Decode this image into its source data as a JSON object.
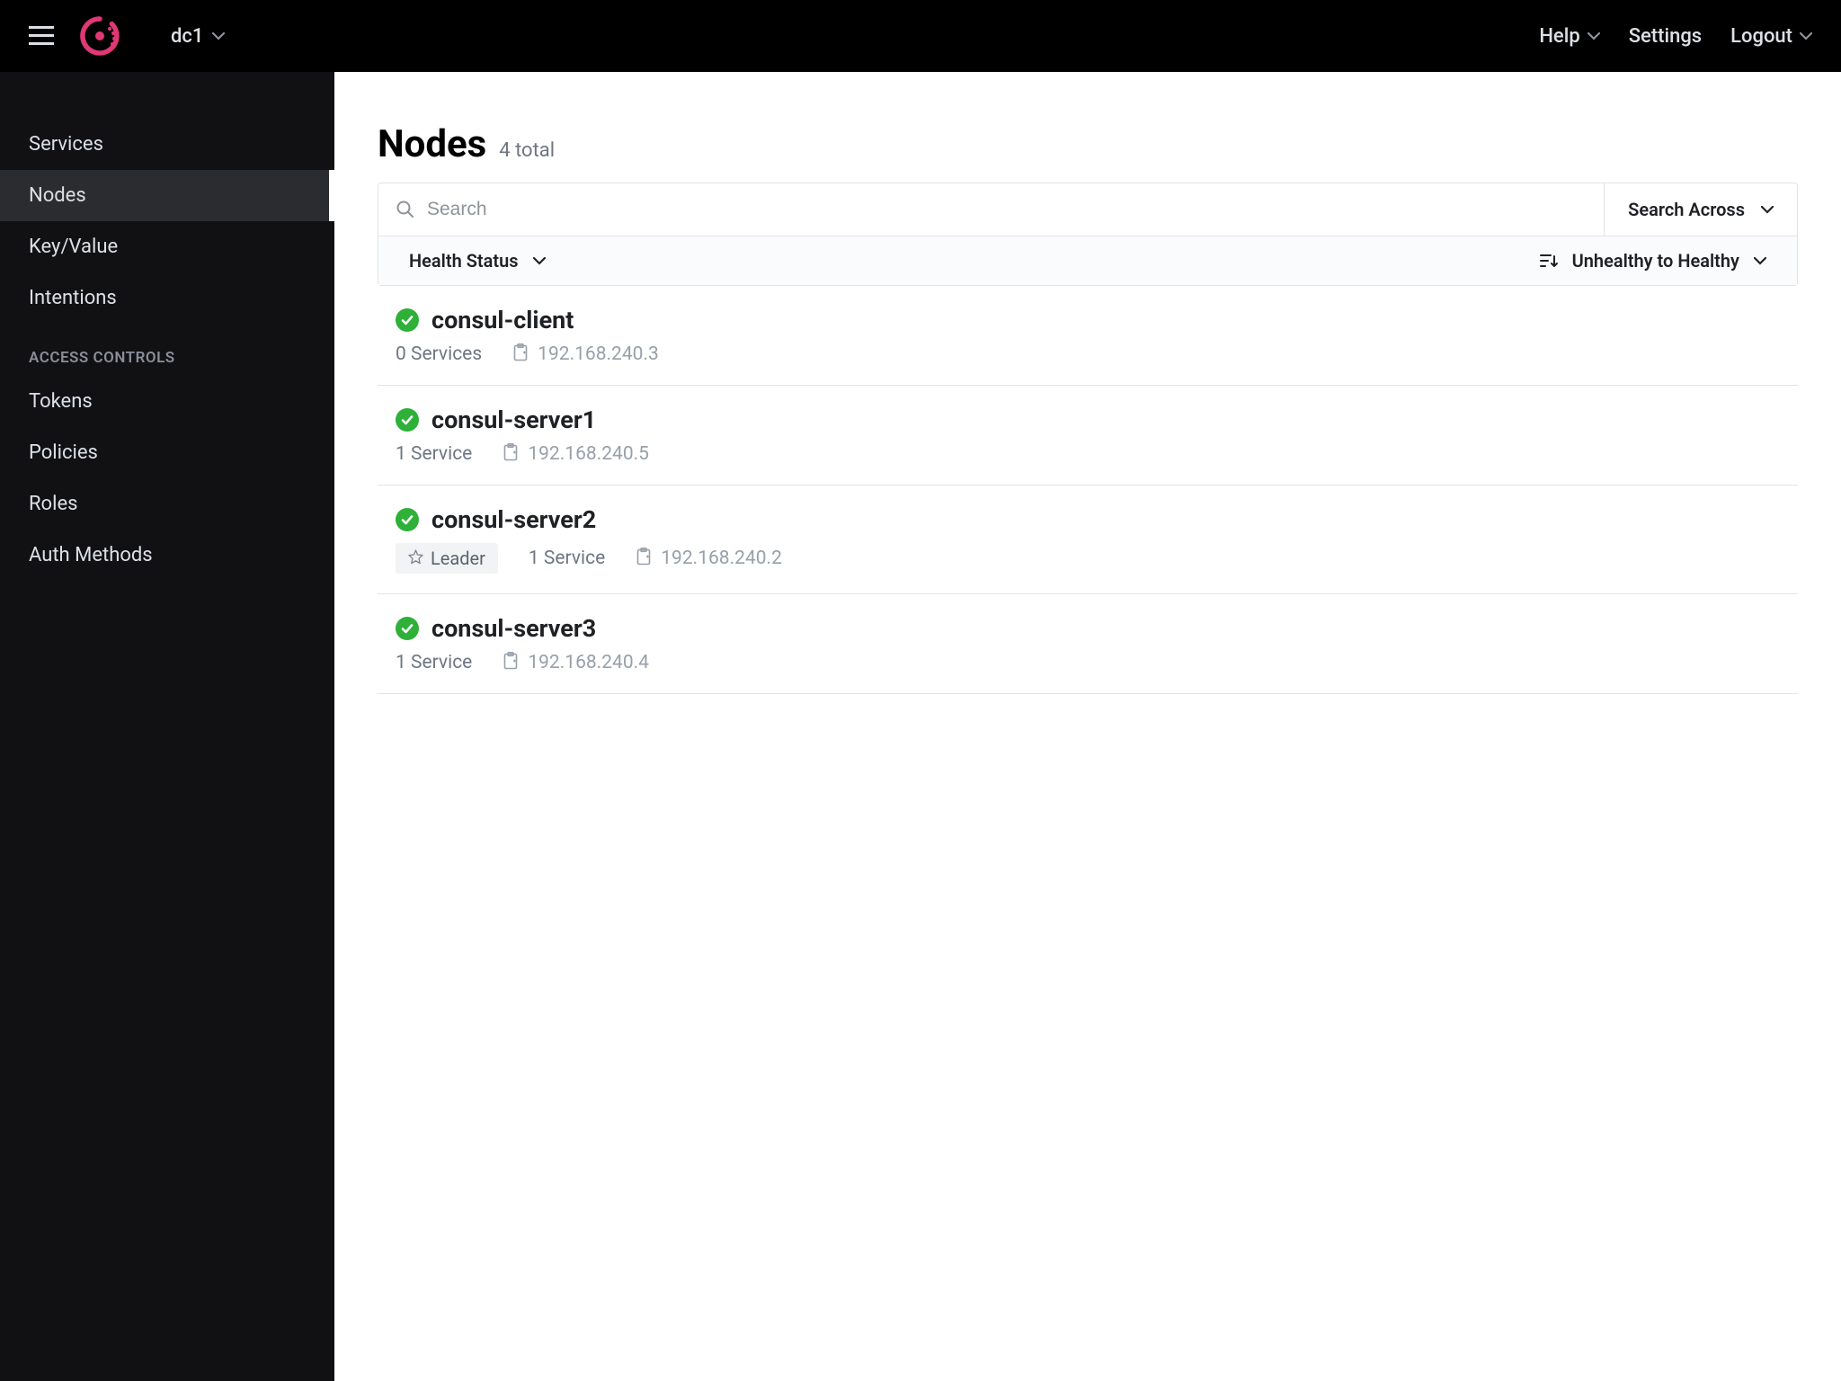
{
  "header": {
    "datacenter": "dc1",
    "help_label": "Help",
    "settings_label": "Settings",
    "logout_label": "Logout"
  },
  "sidebar": {
    "items": [
      {
        "label": "Services",
        "active": false
      },
      {
        "label": "Nodes",
        "active": true
      },
      {
        "label": "Key/Value",
        "active": false
      },
      {
        "label": "Intentions",
        "active": false
      }
    ],
    "section_label": "ACCESS CONTROLS",
    "access_items": [
      {
        "label": "Tokens"
      },
      {
        "label": "Policies"
      },
      {
        "label": "Roles"
      },
      {
        "label": "Auth Methods"
      }
    ]
  },
  "page": {
    "title": "Nodes",
    "subtitle": "4 total",
    "search_placeholder": "Search",
    "search_across_label": "Search Across",
    "filter_status_label": "Health Status",
    "sort_label": "Unhealthy to Healthy"
  },
  "nodes": [
    {
      "name": "consul-client",
      "service_text": "0 Services",
      "ip": "192.168.240.3",
      "leader": false
    },
    {
      "name": "consul-server1",
      "service_text": "1 Service",
      "ip": "192.168.240.5",
      "leader": false
    },
    {
      "name": "consul-server2",
      "service_text": "1 Service",
      "ip": "192.168.240.2",
      "leader": true,
      "leader_label": "Leader"
    },
    {
      "name": "consul-server3",
      "service_text": "1 Service",
      "ip": "192.168.240.4",
      "leader": false
    }
  ]
}
